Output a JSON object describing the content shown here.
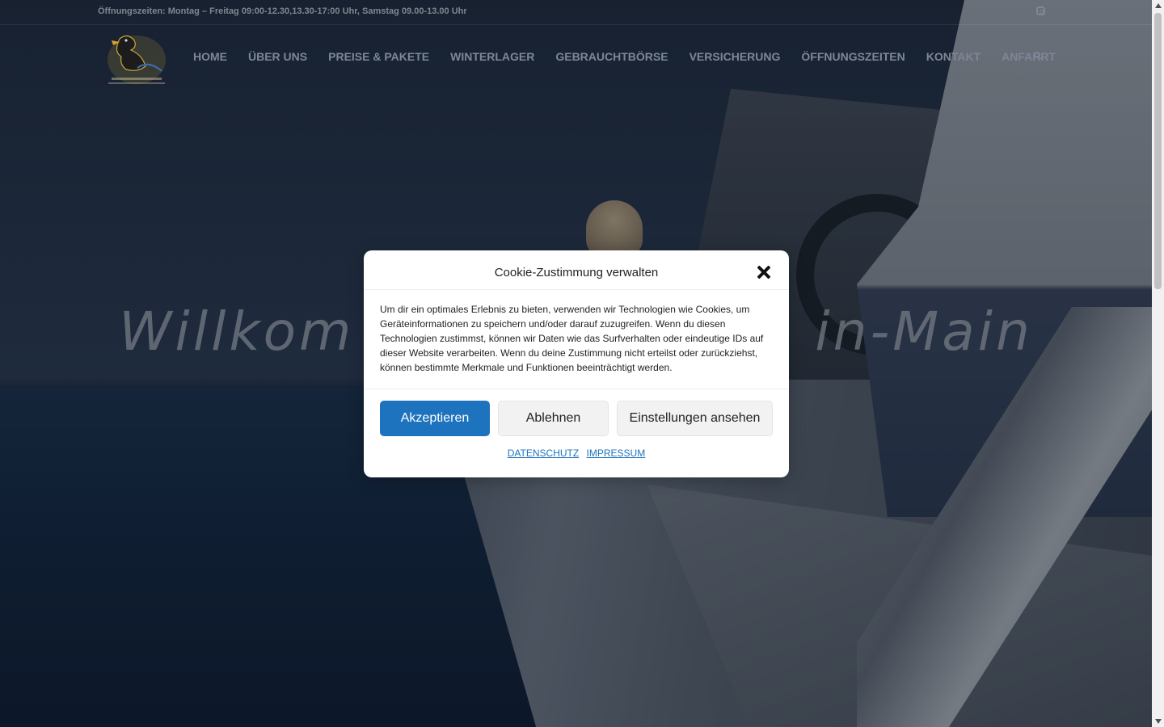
{
  "topbar": {
    "opening_hours": "Öffnungszeiten: Montag – Freitag 09:00-12.30,13.30-17:00 Uhr, Samstag 09.00-13.00 Uhr",
    "social_icon": "instagram-icon"
  },
  "header": {
    "logo_icon": "duck-logo",
    "nav": [
      {
        "label": "HOME"
      },
      {
        "label": "ÜBER UNS"
      },
      {
        "label": "PREISE & PAKETE"
      },
      {
        "label": "WINTERLAGER"
      },
      {
        "label": "GEBRAUCHTBÖRSE"
      },
      {
        "label": "VERSICHERUNG"
      },
      {
        "label": "ÖFFNUNGSZEITEN"
      },
      {
        "label": "KONTAKT"
      },
      {
        "label": "ANFAHRT"
      }
    ],
    "search_icon": "search-icon"
  },
  "hero": {
    "title_left": "Willkom",
    "title_right": "in-Main"
  },
  "cookie_modal": {
    "title": "Cookie-Zustimmung verwalten",
    "body": "Um dir ein optimales Erlebnis zu bieten, verwenden wir Technologien wie Cookies, um Geräteinformationen zu speichern und/oder darauf zuzugreifen. Wenn du diesen Technologien zustimmst, können wir Daten wie das Surfverhalten oder eindeutige IDs auf dieser Website verarbeiten. Wenn du deine Zustimmung nicht erteilst oder zurückziehst, können bestimmte Merkmale und Funktionen beeinträchtigt werden.",
    "accept_label": "Akzeptieren",
    "deny_label": "Ablehnen",
    "settings_label": "Einstellungen ansehen",
    "link_privacy": "DATENSCHUTZ",
    "link_imprint": "IMPRESSUM"
  },
  "colors": {
    "accent": "#1e73be",
    "nav_text": "#7e8797"
  }
}
